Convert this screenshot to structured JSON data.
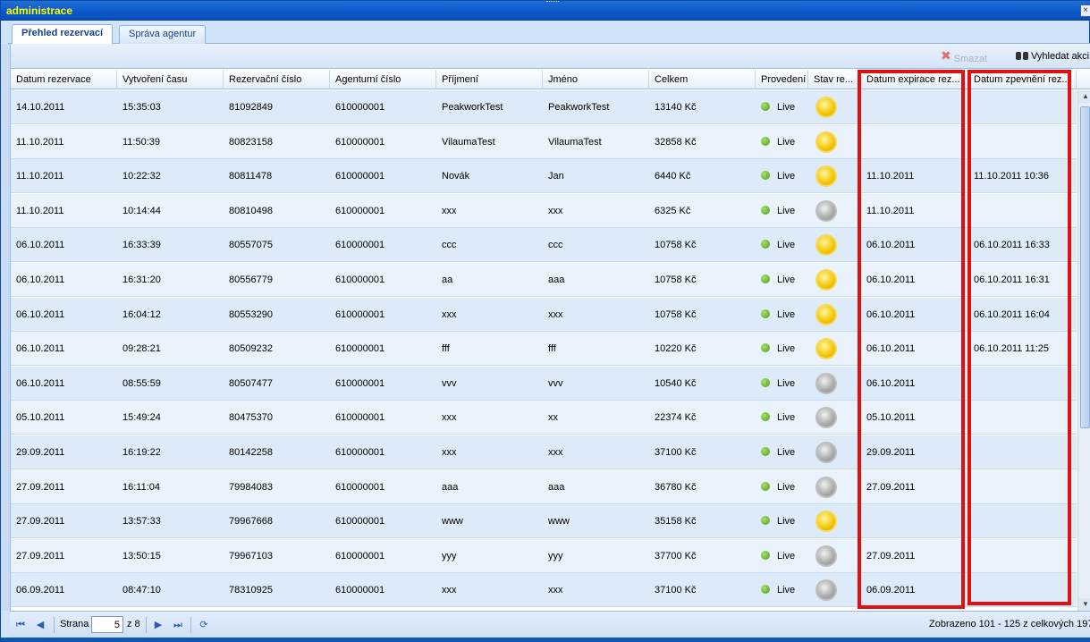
{
  "window": {
    "title": "administrace",
    "close_label": "×"
  },
  "tabs": [
    {
      "label": "Přehled rezervací",
      "active": true
    },
    {
      "label": "Správa agentur",
      "active": false
    }
  ],
  "toolbar": {
    "delete_label": "Smazat",
    "search_label": "Vyhledat akci"
  },
  "columns": [
    "Datum rezervace",
    "Vytvoření času",
    "Rezervační číslo",
    "Agenturní číslo",
    "Příjmení",
    "Jméno",
    "Celkem",
    "Provedení",
    "Stav re...",
    "Datum expirace rez...",
    "Datum zpevnění rez..."
  ],
  "rows": [
    {
      "date": "14.10.2011",
      "time": "15:35:03",
      "res_no": "81092849",
      "agency_no": "610000001",
      "surname": "PeakworkTest",
      "name": "PeakworkTest",
      "total": "13140 Kč",
      "mode": "Live",
      "status": "yellow",
      "expiry": "",
      "confirm": ""
    },
    {
      "date": "11.10.2011",
      "time": "11:50:39",
      "res_no": "80823158",
      "agency_no": "610000001",
      "surname": "VilaumaTest",
      "name": "VilaumaTest",
      "total": "32858 Kč",
      "mode": "Live",
      "status": "yellow",
      "expiry": "",
      "confirm": ""
    },
    {
      "date": "11.10.2011",
      "time": "10:22:32",
      "res_no": "80811478",
      "agency_no": "610000001",
      "surname": "Novák",
      "name": "Jan",
      "total": "6440 Kč",
      "mode": "Live",
      "status": "yellow",
      "expiry": "11.10.2011",
      "confirm": "11.10.2011 10:36"
    },
    {
      "date": "11.10.2011",
      "time": "10:14:44",
      "res_no": "80810498",
      "agency_no": "610000001",
      "surname": "xxx",
      "name": "xxx",
      "total": "6325 Kč",
      "mode": "Live",
      "status": "gray",
      "expiry": "11.10.2011",
      "confirm": ""
    },
    {
      "date": "06.10.2011",
      "time": "16:33:39",
      "res_no": "80557075",
      "agency_no": "610000001",
      "surname": "ccc",
      "name": "ccc",
      "total": "10758 Kč",
      "mode": "Live",
      "status": "yellow",
      "expiry": "06.10.2011",
      "confirm": "06.10.2011 16:33"
    },
    {
      "date": "06.10.2011",
      "time": "16:31:20",
      "res_no": "80556779",
      "agency_no": "610000001",
      "surname": "aa",
      "name": "aaa",
      "total": "10758 Kč",
      "mode": "Live",
      "status": "yellow",
      "expiry": "06.10.2011",
      "confirm": "06.10.2011 16:31"
    },
    {
      "date": "06.10.2011",
      "time": "16:04:12",
      "res_no": "80553290",
      "agency_no": "610000001",
      "surname": "xxx",
      "name": "xxx",
      "total": "10758 Kč",
      "mode": "Live",
      "status": "yellow",
      "expiry": "06.10.2011",
      "confirm": "06.10.2011 16:04"
    },
    {
      "date": "06.10.2011",
      "time": "09:28:21",
      "res_no": "80509232",
      "agency_no": "610000001",
      "surname": "fff",
      "name": "fff",
      "total": "10220 Kč",
      "mode": "Live",
      "status": "yellow",
      "expiry": "06.10.2011",
      "confirm": "06.10.2011 11:25"
    },
    {
      "date": "06.10.2011",
      "time": "08:55:59",
      "res_no": "80507477",
      "agency_no": "610000001",
      "surname": "vvv",
      "name": "vvv",
      "total": "10540 Kč",
      "mode": "Live",
      "status": "gray",
      "expiry": "06.10.2011",
      "confirm": ""
    },
    {
      "date": "05.10.2011",
      "time": "15:49:24",
      "res_no": "80475370",
      "agency_no": "610000001",
      "surname": "xxx",
      "name": "xx",
      "total": "22374 Kč",
      "mode": "Live",
      "status": "gray",
      "expiry": "05.10.2011",
      "confirm": ""
    },
    {
      "date": "29.09.2011",
      "time": "16:19:22",
      "res_no": "80142258",
      "agency_no": "610000001",
      "surname": "xxx",
      "name": "xxx",
      "total": "37100 Kč",
      "mode": "Live",
      "status": "gray",
      "expiry": "29.09.2011",
      "confirm": ""
    },
    {
      "date": "27.09.2011",
      "time": "16:11:04",
      "res_no": "79984083",
      "agency_no": "610000001",
      "surname": "aaa",
      "name": "aaa",
      "total": "36780 Kč",
      "mode": "Live",
      "status": "gray",
      "expiry": "27.09.2011",
      "confirm": ""
    },
    {
      "date": "27.09.2011",
      "time": "13:57:33",
      "res_no": "79967668",
      "agency_no": "610000001",
      "surname": "www",
      "name": "www",
      "total": "35158 Kč",
      "mode": "Live",
      "status": "yellow",
      "expiry": "",
      "confirm": ""
    },
    {
      "date": "27.09.2011",
      "time": "13:50:15",
      "res_no": "79967103",
      "agency_no": "610000001",
      "surname": "yyy",
      "name": "yyy",
      "total": "37700 Kč",
      "mode": "Live",
      "status": "gray",
      "expiry": "27.09.2011",
      "confirm": ""
    },
    {
      "date": "06.09.2011",
      "time": "08:47:10",
      "res_no": "78310925",
      "agency_no": "610000001",
      "surname": "xxx",
      "name": "xxx",
      "total": "37100 Kč",
      "mode": "Live",
      "status": "gray",
      "expiry": "06.09.2011",
      "confirm": ""
    }
  ],
  "pager": {
    "page_label": "Strana",
    "current_page": "5",
    "of_label": "z 8",
    "info": "Zobrazeno 101 - 125 z celkových 197"
  }
}
